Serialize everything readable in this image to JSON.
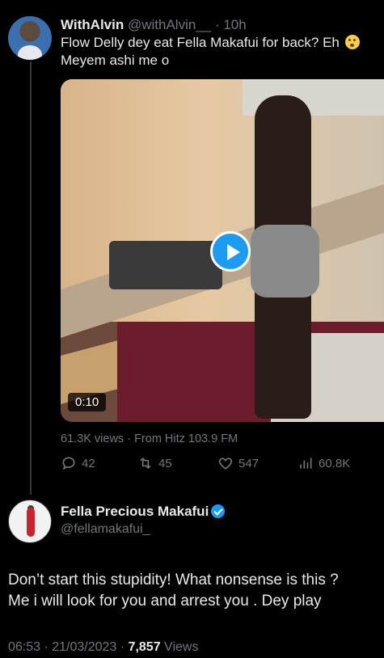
{
  "tweet": {
    "author_name": "WithAlvin",
    "author_handle": "@withAlvin__",
    "time_separator": " · ",
    "time": "10h",
    "text_line1": "Flow Delly dey eat Fella Makafui for back? Eh",
    "text_line2": "Meyem ashi me o",
    "emoji": "flushed-face-emoji",
    "video_duration": "0:10",
    "views_line": "61.3K views · From Hitz 103.9 FM",
    "replies": "42",
    "retweets": "45",
    "likes": "547",
    "analytics": "60.8K"
  },
  "reply": {
    "author_name": "Fella Precious Makafui",
    "author_handle": "@fellamakafui_",
    "verified": true,
    "text_line1": "Don’t start this stupidity! What nonsense is this ?",
    "text_line2": "Me i will look for you and arrest you . Dey play",
    "timestamp": "06:53 · 21/03/2023 · ",
    "view_count": "7,857",
    "views_label": " Views"
  },
  "colors": {
    "background": "#000000",
    "text": "#e7e9ea",
    "muted": "#71767b",
    "accent": "#1d9bf0"
  }
}
